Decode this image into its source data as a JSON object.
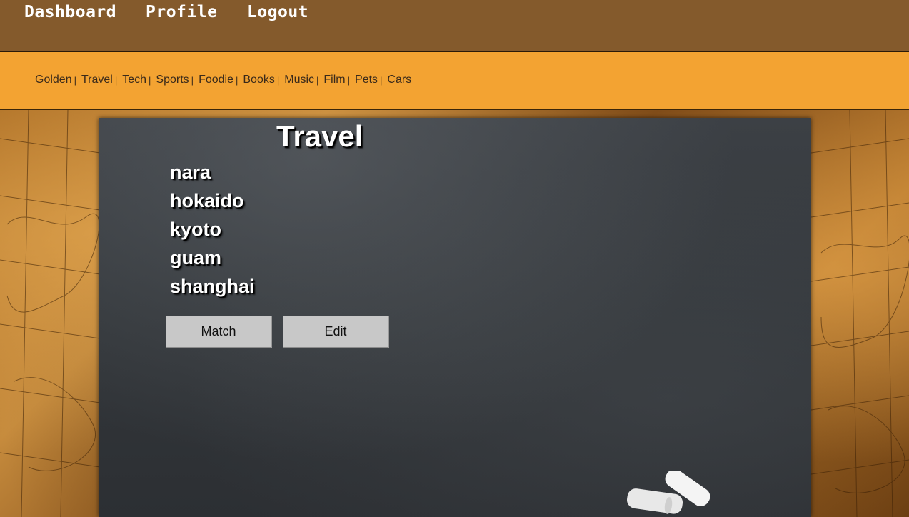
{
  "topnav": {
    "links": [
      {
        "label": "Dashboard"
      },
      {
        "label": "Profile"
      },
      {
        "label": "Logout"
      }
    ]
  },
  "categories": {
    "items": [
      "Golden",
      "Travel",
      "Tech",
      "Sports",
      "Foodie",
      "Books",
      "Music",
      "Film",
      "Pets",
      "Cars"
    ],
    "separator": "|"
  },
  "board": {
    "title": "Travel",
    "places": [
      "nara",
      "hokaido",
      "kyoto",
      "guam",
      "shanghai"
    ],
    "match_label": "Match",
    "edit_label": "Edit"
  },
  "colors": {
    "topbar": "#845a2c",
    "catbar": "#f3a332",
    "board": "#33373b",
    "button": "#c8c8c8"
  },
  "icons": {
    "chalk": "chalk-icon",
    "background": "world-map"
  }
}
